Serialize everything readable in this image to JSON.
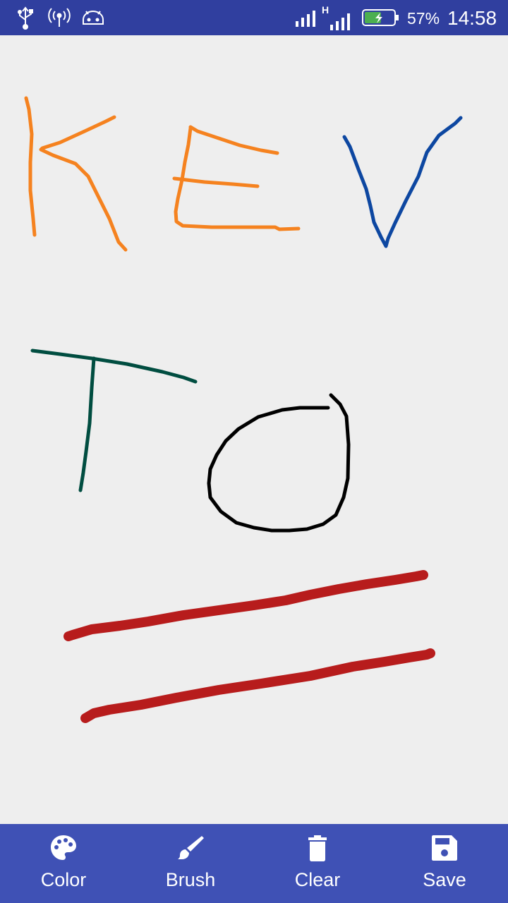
{
  "status_bar": {
    "icons": [
      "usb-icon",
      "hotspot-icon",
      "android-debug-icon",
      "signal-icon",
      "signal-h-icon",
      "battery-charging-icon"
    ],
    "network_type": "H",
    "battery_percent": "57%",
    "time": "14:58",
    "battery_level": 0.57,
    "battery_color": "#4caf50"
  },
  "canvas": {
    "background": "#eeeeee",
    "strokes": [
      {
        "label": "K",
        "color": "#f5821f"
      },
      {
        "label": "E",
        "color": "#f5821f"
      },
      {
        "label": "V",
        "color": "#0d47a1"
      },
      {
        "label": "T",
        "color": "#004d40"
      },
      {
        "label": "O",
        "color": "#000000"
      },
      {
        "label": "line-1",
        "color": "#b71c1c"
      },
      {
        "label": "line-2",
        "color": "#b71c1c"
      }
    ]
  },
  "toolbar": {
    "background": "#3f51b5",
    "items": [
      {
        "label": "Color",
        "icon": "palette-icon"
      },
      {
        "label": "Brush",
        "icon": "brush-icon"
      },
      {
        "label": "Clear",
        "icon": "trash-icon"
      },
      {
        "label": "Save",
        "icon": "save-icon"
      }
    ]
  }
}
